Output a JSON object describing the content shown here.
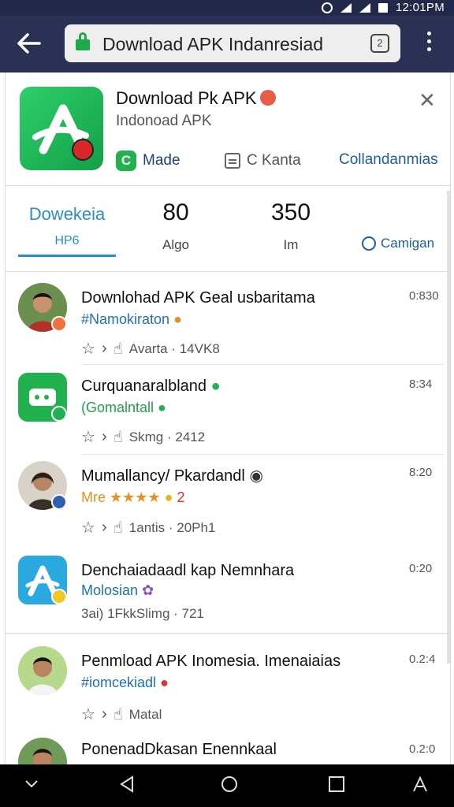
{
  "status": {
    "time": "12:01PM"
  },
  "browser": {
    "url": "Download APK Indanresiad",
    "tabs_count": "2"
  },
  "app": {
    "title": "Download Pk APK",
    "subtitle": "Indonoad APK",
    "made_badge": "C",
    "made_label": "Made",
    "kanta_label": "C Kanta",
    "calendar_label": "Collandanmias"
  },
  "stats": {
    "tab_value": "Dowekeia",
    "tab_label": "HP6",
    "s1_value": "80",
    "s1_label": "Algo",
    "s2_value": "350",
    "s2_label": "Im",
    "campaign_label": "Camigan"
  },
  "items": [
    {
      "title": "Downlohad APK Geal usbaritama",
      "tag": "#Namokiraton",
      "meta": "Avarta · 14VK8",
      "time": "0:830"
    },
    {
      "title": "Curquanaralbland",
      "tag": "(Gomalntall",
      "meta": "Skmg · 2412",
      "time": "8:34"
    },
    {
      "title": "Mumallancy/ Pkardandl",
      "tag": "Mre ★★★★",
      "tag_extra": "2",
      "meta": "1antis · 20Ph1",
      "time": "8:20"
    },
    {
      "title": "Denchaiadaadl kap Nemnhara",
      "tag": "Molosian",
      "meta": "3ai) 1FkkSlimg · 721",
      "time": "0:20"
    },
    {
      "title": "Penmload APK Inomesia. Imenaiaias",
      "tag": "#iomcekiadl",
      "meta": "Matal",
      "time": "0.2:4"
    },
    {
      "title": "PonenadDkasan Enennkaal",
      "time": "0.2:0"
    }
  ],
  "colors": {
    "accent": "#2a8fc7",
    "brand_green": "#1ea84a",
    "header": "#2b3155"
  }
}
